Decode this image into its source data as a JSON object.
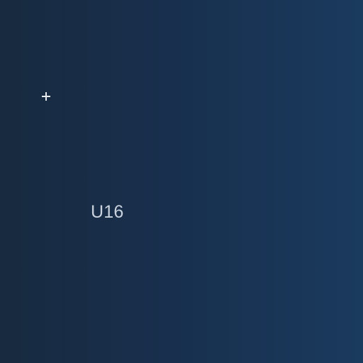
{
  "canvas": {
    "label": "U16",
    "icon": "plus-icon",
    "colors": {
      "background_left": "#172a3f",
      "background_right": "#1a3a5e",
      "icon": "#e6ebf0",
      "label": "#c9d2dc"
    }
  }
}
